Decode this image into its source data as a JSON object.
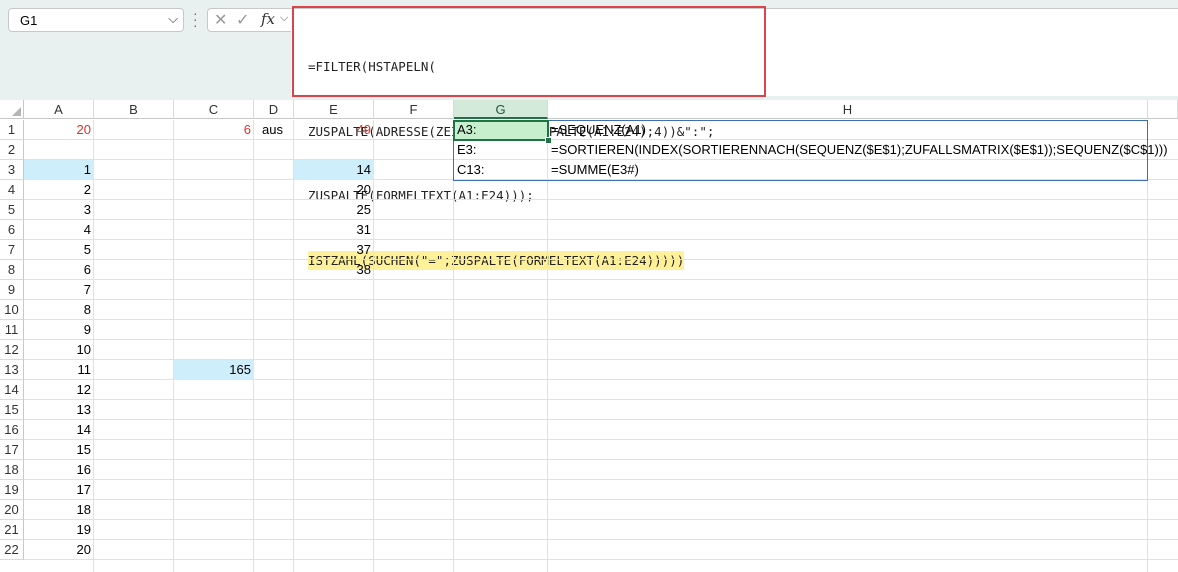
{
  "name_box": {
    "value": "G1"
  },
  "formula_bar": {
    "fx_label": "fx",
    "lines": [
      "=FILTER(HSTAPELN(",
      "ZUSPALTE(ADRESSE(ZEILE(A1:E24);SPALTE(A1:E24);4))&\":\";",
      "ZUSPALTE(FORMELTEXT(A1:E24)));",
      "ISTZAHL(SUCHEN(\"=\";ZUSPALTE(FORMELTEXT(A1:E24)))))"
    ]
  },
  "columns": [
    "A",
    "B",
    "C",
    "D",
    "E",
    "F",
    "G",
    "H"
  ],
  "rows": [
    "1",
    "2",
    "3",
    "4",
    "5",
    "6",
    "7",
    "8",
    "9",
    "10",
    "11",
    "12",
    "13",
    "14",
    "15",
    "16",
    "17",
    "18",
    "19",
    "20",
    "21",
    "22"
  ],
  "cells": {
    "A1": "20",
    "C1": "6",
    "D1": "aus",
    "E1": "49",
    "A3": "1",
    "A4": "2",
    "A5": "3",
    "A6": "4",
    "A7": "5",
    "A8": "6",
    "A9": "7",
    "A10": "8",
    "A11": "9",
    "A12": "10",
    "A13": "11",
    "A14": "12",
    "A15": "13",
    "A16": "14",
    "A17": "15",
    "A18": "16",
    "A19": "17",
    "A20": "18",
    "A21": "19",
    "A22": "20",
    "E3": "14",
    "E4": "20",
    "E5": "25",
    "E6": "31",
    "E7": "37",
    "E8": "38",
    "C13": "165",
    "G1": "A3:",
    "G2": "E3:",
    "G3": "C13:",
    "H1": "=SEQUENZ(A1)",
    "H2": "=SORTIEREN(INDEX(SORTIERENNACH(SEQUENZ($E$1);ZUFALLSMATRIX($E$1));SEQUENZ($C$1)))",
    "H3": "=SUMME(E3#)"
  },
  "colors": {
    "accent_green": "#207245",
    "highlight_red": "#d9454a",
    "spill_blue": "#cdeefa",
    "formula_highlight": "#fff19a"
  }
}
